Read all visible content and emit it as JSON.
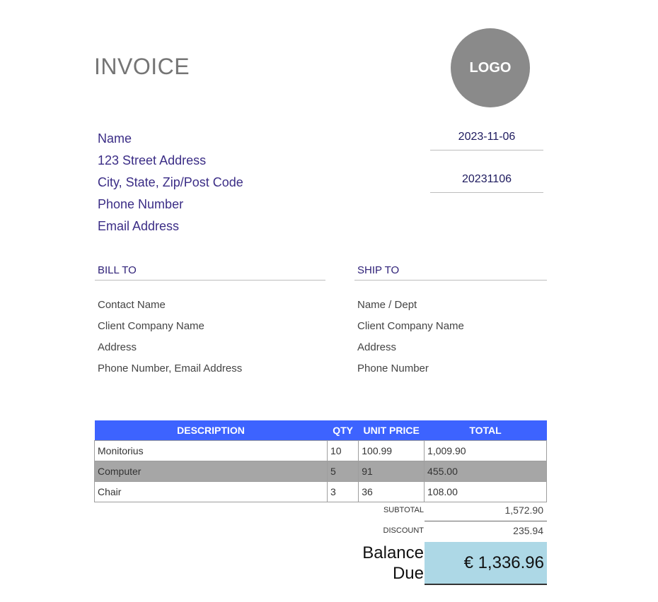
{
  "invoice": {
    "title": "INVOICE",
    "logo_text": "LOGO",
    "date": "2023-11-06",
    "number": "20231106"
  },
  "sender": {
    "name": "Name",
    "street": "123 Street Address",
    "city": "City, State, Zip/Post Code",
    "phone": "Phone Number",
    "email": "Email Address"
  },
  "bill_to": {
    "heading": "BILL TO",
    "lines": [
      "Contact Name",
      "Client Company Name",
      "Address",
      "Phone Number, Email Address"
    ]
  },
  "ship_to": {
    "heading": "SHIP TO",
    "lines": [
      "Name / Dept",
      "Client Company Name",
      "Address",
      "Phone Number"
    ]
  },
  "table": {
    "headers": [
      "DESCRIPTION",
      "QTY",
      "UNIT PRICE",
      "TOTAL"
    ],
    "rows": [
      [
        "Monitorius",
        "10",
        "100.99",
        "1,009.90"
      ],
      [
        "Computer",
        "5",
        "91",
        "455.00"
      ],
      [
        "Chair",
        "3",
        "36",
        "108.00"
      ]
    ]
  },
  "summary": {
    "subtotal_label": "SUBTOTAL",
    "subtotal_value": "1,572.90",
    "discount_label": "DISCOUNT",
    "discount_value": "235.94",
    "balance_label_line1": "Balance",
    "balance_label_line2": "Due",
    "balance_value": "€ 1,336.96"
  },
  "colors": {
    "header_blue": "#3d63ff",
    "accent_purple": "#3b2d86",
    "balance_bg": "#add8e6",
    "shaded_row": "#a6a6a6"
  }
}
